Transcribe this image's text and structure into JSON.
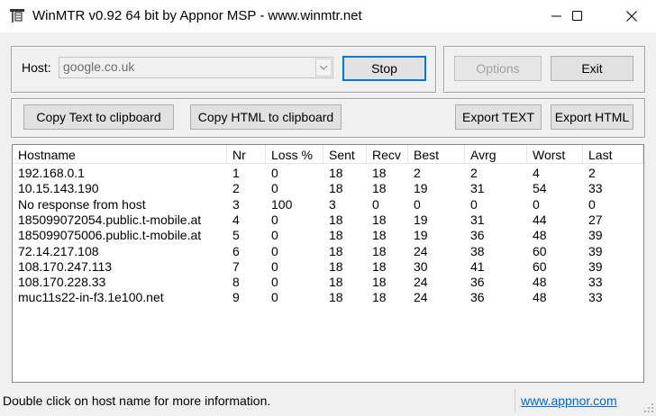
{
  "window": {
    "title": "WinMTR v0.92 64 bit by Appnor MSP - www.winmtr.net"
  },
  "controls": {
    "host_label": "Host:",
    "host_value": "google.co.uk",
    "stop_label": "Stop",
    "options_label": "Options",
    "exit_label": "Exit",
    "copy_text_label": "Copy Text to clipboard",
    "copy_html_label": "Copy HTML to clipboard",
    "export_text_label": "Export TEXT",
    "export_html_label": "Export HTML"
  },
  "table": {
    "columns": [
      "Hostname",
      "Nr",
      "Loss %",
      "Sent",
      "Recv",
      "Best",
      "Avrg",
      "Worst",
      "Last"
    ],
    "rows": [
      [
        "192.168.0.1",
        "1",
        "0",
        "18",
        "18",
        "2",
        "2",
        "4",
        "2"
      ],
      [
        "10.15.143.190",
        "2",
        "0",
        "18",
        "18",
        "19",
        "31",
        "54",
        "33"
      ],
      [
        "No response from host",
        "3",
        "100",
        "3",
        "0",
        "0",
        "0",
        "0",
        "0"
      ],
      [
        "185099072054.public.t-mobile.at",
        "4",
        "0",
        "18",
        "18",
        "19",
        "31",
        "44",
        "27"
      ],
      [
        "185099075006.public.t-mobile.at",
        "5",
        "0",
        "18",
        "18",
        "19",
        "36",
        "48",
        "39"
      ],
      [
        "72.14.217.108",
        "6",
        "0",
        "18",
        "18",
        "24",
        "38",
        "60",
        "39"
      ],
      [
        "108.170.247.113",
        "7",
        "0",
        "18",
        "18",
        "30",
        "41",
        "60",
        "39"
      ],
      [
        "108.170.228.33",
        "8",
        "0",
        "18",
        "18",
        "24",
        "36",
        "48",
        "33"
      ],
      [
        "muc11s22-in-f3.1e100.net",
        "9",
        "0",
        "18",
        "18",
        "24",
        "36",
        "48",
        "33"
      ]
    ]
  },
  "status": {
    "message": "Double click on host name for more information.",
    "link": "www.appnor.com"
  },
  "icons": {
    "app": "network-tool-icon",
    "minimize": "minimize-icon",
    "maximize": "maximize-icon",
    "close": "close-icon",
    "dropdown": "chevron-down-icon",
    "grip": "resize-grip-icon"
  },
  "colors": {
    "window_bg": "#f0f0f0",
    "default_button_border": "#0078d7",
    "link": "#0066cc",
    "disabled_text": "#a0a0a0"
  }
}
